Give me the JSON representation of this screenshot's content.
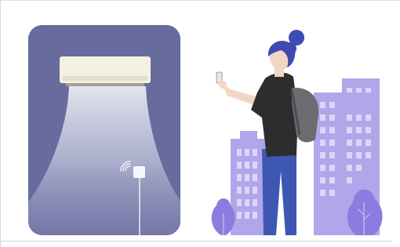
{
  "illustration": {
    "left_panel": {
      "subject": "air-conditioner",
      "icons": [
        "air-conditioner-icon",
        "airflow-icon",
        "wifi-signal-icon",
        "sensor-icon"
      ]
    },
    "right_panel": {
      "subject": "person-with-phone",
      "icons": [
        "person-figure",
        "smartphone-icon",
        "backpack-icon",
        "city-buildings",
        "tree-icon"
      ]
    },
    "colors": {
      "card_background": "#676b9d",
      "airflow_light": "#e9ebf2",
      "ac_unit": "#f4f1e3",
      "hair_blue": "#3e4bb0",
      "jeans_blue": "#3e57b4",
      "shirt_dark": "#2d2d2f",
      "backpack_gray": "#6b6b70",
      "building_lavender": "#b1a6ea",
      "building_purple": "#8b7de0",
      "skin": "#f1d6c4"
    }
  }
}
